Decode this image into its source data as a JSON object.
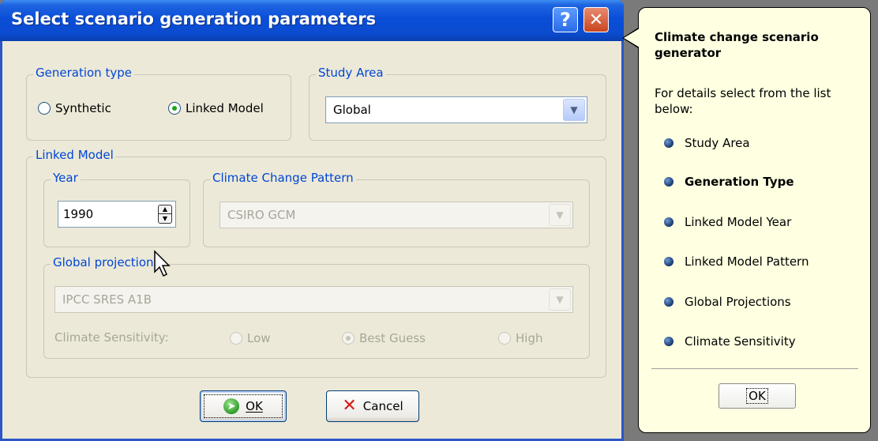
{
  "dialog": {
    "title": "Select scenario generation parameters",
    "help_button": "?",
    "close_button": "✕",
    "generation_type": {
      "legend": "Generation type",
      "options": [
        "Synthetic",
        "Linked Model"
      ],
      "selected": "Linked Model"
    },
    "study_area": {
      "legend": "Study Area",
      "value": "Global"
    },
    "linked_model": {
      "legend": "Linked Model",
      "year": {
        "legend": "Year",
        "value": "1990"
      },
      "pattern": {
        "legend": "Climate Change Pattern",
        "value": "CSIRO GCM"
      },
      "global_projections": {
        "legend": "Global projections",
        "value": "IPCC SRES A1B",
        "sensitivity_label": "Climate Sensitivity:",
        "sensitivity_options": [
          "Low",
          "Best Guess",
          "High"
        ],
        "sensitivity_selected": "Best Guess"
      }
    },
    "ok_label": "OK",
    "cancel_label": "Cancel"
  },
  "help_balloon": {
    "title": "Climate change scenario generator",
    "description": "For details select from the list below:",
    "items": [
      "Study Area",
      "Generation Type",
      "Linked Model Year",
      "Linked Model Pattern",
      "Global Projections",
      "Climate Sensitivity"
    ],
    "active_item": "Generation Type",
    "ok_label": "OK"
  },
  "colors": {
    "titlebar": "#0a4ed8",
    "group_legend": "#0046d5",
    "dialog_bg": "#ece9d8",
    "balloon_bg": "#ffffe1"
  },
  "icons": [
    "help-icon",
    "close-icon",
    "chevron-down-icon",
    "spin-up-icon",
    "spin-down-icon",
    "ok-check-icon",
    "cancel-x-icon",
    "bullet-icon",
    "mouse-cursor-icon"
  ]
}
